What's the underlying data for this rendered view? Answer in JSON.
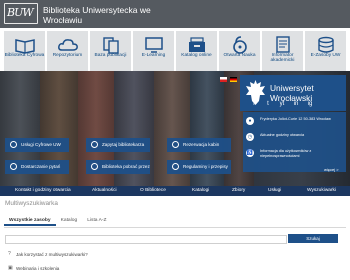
{
  "header": {
    "logo_text": "BUW",
    "title_line1": "Biblioteka Uniwersytecka we",
    "title_line2": "Wrocławiu"
  },
  "icon_bar": {
    "tiles": [
      {
        "label": "Biblioteka Cyfrowa",
        "icon": "book-open-icon"
      },
      {
        "label": "Repozytorium",
        "icon": "cloud-icon"
      },
      {
        "label": "Baza publikacji",
        "icon": "publications-icon"
      },
      {
        "label": "E-Learning",
        "icon": "monitor-icon"
      },
      {
        "label": "Katalog online",
        "icon": "catalog-box-icon"
      },
      {
        "label": "Otwarta Nauka",
        "icon": "lock-icon"
      },
      {
        "label": "Informator akademicki",
        "icon": "document-icon"
      },
      {
        "label": "E-Zasoby UW",
        "icon": "database-icon"
      }
    ]
  },
  "hero": {
    "university_line1": "Uniwersytet",
    "university_line2": "Wrocławski",
    "info": [
      {
        "text": "Fryderyka Joliot-Curie 12 50-383 Wrocław",
        "icon": "location-icon"
      },
      {
        "text": "Aktualne godziny otwarcia",
        "icon": "clock-icon"
      },
      {
        "text": "Informacja dla użytkowników z niepełnosprawnościami",
        "icon": "accessibility-icon"
      }
    ],
    "next_link": "więcej >",
    "quick_buttons": [
      {
        "label": "Usługi Cyfrowe UW",
        "icon": "digital-icon"
      },
      {
        "label": "Zapytaj bibliotekarza",
        "icon": "chat-icon"
      },
      {
        "label": "Rezerwacja kabin",
        "icon": "calendar-icon"
      },
      {
        "label": "Dostarczanie pytań",
        "icon": "delivery-icon"
      },
      {
        "label": "Biblioteka pobrać przez",
        "icon": "download-icon"
      },
      {
        "label": "Regulaminy i przepisy",
        "icon": "rules-icon"
      }
    ],
    "calendar_day": "31",
    "social": [
      "f",
      "t",
      "yt",
      "in",
      "ig"
    ]
  },
  "nav": {
    "items": [
      "Kontakt i godziny otwarcia",
      "Aktualności",
      "O Bibliotece",
      "Katalogi",
      "Zbiory",
      "Usługi",
      "Wyszukiwarki"
    ]
  },
  "search": {
    "title": "Multiwyszukiwarka",
    "tabs": [
      "Wszystkie zasoby",
      "Katalog",
      "Lista A-Z"
    ],
    "active_tab": 0,
    "placeholder": "",
    "button": "Szukaj"
  },
  "footer_links": [
    {
      "label": "Jak korzystać z multiwyszukiwarki?",
      "icon": "help-icon"
    },
    {
      "label": "Webinaria i szkolenia",
      "icon": "webinar-icon"
    }
  ],
  "colors": {
    "header_bg": "#555a60",
    "tile_bg": "#dfe1e3",
    "primary_blue": "#1e5089",
    "nav_bg": "#1c3760"
  }
}
